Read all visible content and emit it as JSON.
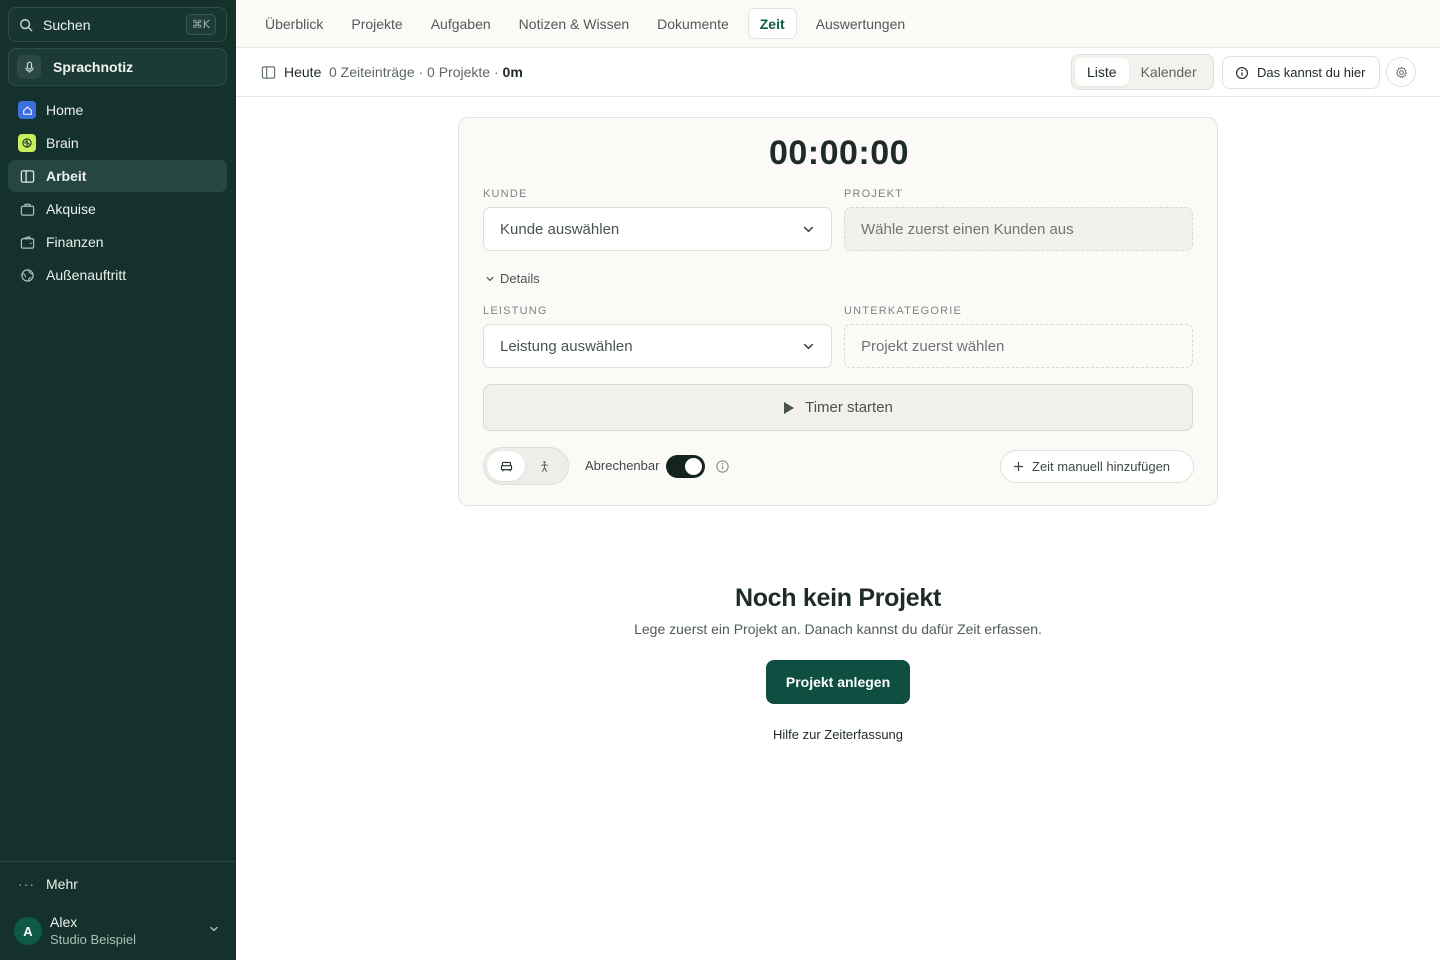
{
  "sidebar": {
    "search": {
      "label": "Suchen",
      "shortcut": "⌘K"
    },
    "voice_note": {
      "label": "Sprachnotiz"
    },
    "items": [
      {
        "label": "Home",
        "icon": "home-icon"
      },
      {
        "label": "Brain",
        "icon": "brain-icon"
      },
      {
        "label": "Arbeit",
        "icon": "layout-icon"
      },
      {
        "label": "Akquise",
        "icon": "briefcase-icon"
      },
      {
        "label": "Finanzen",
        "icon": "wallet-icon"
      },
      {
        "label": "Außenauftritt",
        "icon": "globe-icon"
      }
    ],
    "active_item": "Arbeit",
    "more": {
      "label": "Mehr"
    },
    "user": {
      "initial": "A",
      "name": "Alex",
      "organization": "Studio Beispiel"
    }
  },
  "tabs": [
    {
      "label": "Überblick"
    },
    {
      "label": "Projekte"
    },
    {
      "label": "Aufgaben"
    },
    {
      "label": "Notizen & Wissen"
    },
    {
      "label": "Dokumente"
    },
    {
      "label": "Zeit"
    },
    {
      "label": "Auswertungen"
    }
  ],
  "active_tab": "Zeit",
  "subheader": {
    "title": "Heute",
    "meta_prefix": "0 Zeiteinträge · 0 Projekte · ",
    "meta_total": "0m",
    "view_options": [
      {
        "label": "Liste"
      },
      {
        "label": "Kalender"
      }
    ],
    "active_view": "Liste",
    "help_label": "Das kannst du hier"
  },
  "timer": {
    "clock": "00:00:00",
    "client": {
      "label": "KUNDE",
      "value": "Kunde auswählen"
    },
    "project": {
      "label": "PROJEKT",
      "value": "Wähle zuerst einen Kunden aus"
    },
    "details_label": "Details",
    "service": {
      "label": "LEISTUNG",
      "value": "Leistung auswählen"
    },
    "subcategory": {
      "label": "UNTERKATEGORIE",
      "value": "Projekt zuerst wählen"
    },
    "start_label": "Timer starten",
    "billable_label": "Abrechenbar",
    "billable_on": true,
    "manual_label": "Zeit manuell hinzufügen"
  },
  "empty_state": {
    "title": "Noch kein Projekt",
    "subtitle": "Lege zuerst ein Projekt an. Danach kannst du dafür Zeit erfassen.",
    "cta_label": "Projekt anlegen",
    "help_link": "Hilfe zur Zeiterfassung"
  },
  "colors": {
    "sidebar_bg": "#14312b",
    "accent": "#0f4f42",
    "home_icon_bg": "#3b6fe0",
    "brain_icon_bg": "#c8ee5a"
  }
}
